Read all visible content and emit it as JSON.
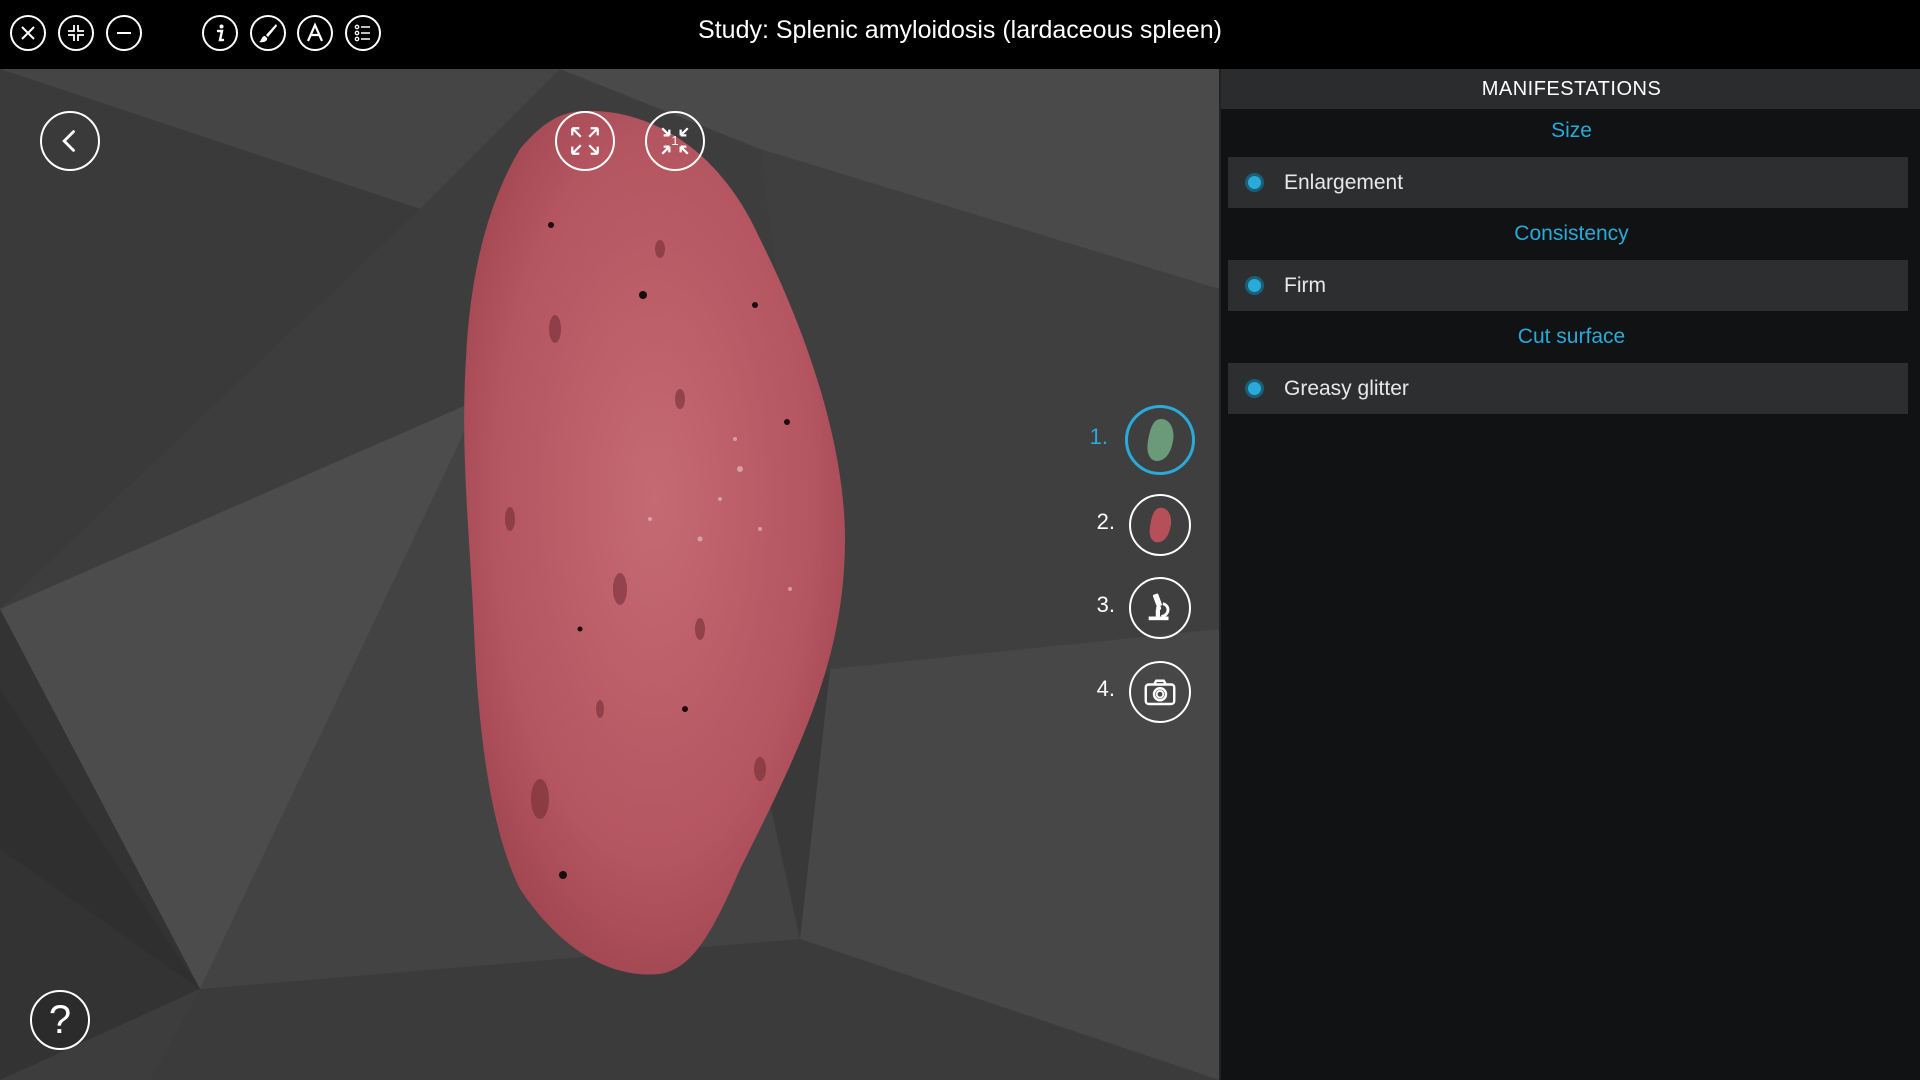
{
  "window": {
    "title": "Study: Splenic amyloidosis (lardaceous spleen)"
  },
  "toolbar": {
    "buttons": [
      {
        "name": "close",
        "icon": "close-icon"
      },
      {
        "name": "compress",
        "icon": "compress-icon"
      },
      {
        "name": "minimize",
        "icon": "minus-icon"
      },
      {
        "name": "info",
        "icon": "info-icon"
      },
      {
        "name": "brush",
        "icon": "brush-icon"
      },
      {
        "name": "labels",
        "icon": "letter-a-icon"
      },
      {
        "name": "list",
        "icon": "list-icon"
      }
    ]
  },
  "viewer": {
    "fit_badge": "1",
    "steps": [
      {
        "label": "1.",
        "icon": "spleen-green-icon",
        "active": true
      },
      {
        "label": "2.",
        "icon": "spleen-red-icon",
        "active": false
      },
      {
        "label": "3.",
        "icon": "microscope-icon",
        "active": false
      },
      {
        "label": "4.",
        "icon": "camera-icon",
        "active": false
      }
    ],
    "help_label": "?"
  },
  "panel": {
    "header": "MANIFESTATIONS",
    "sections": [
      {
        "title": "Size",
        "items": [
          "Enlargement"
        ]
      },
      {
        "title": "Consistency",
        "items": [
          "Firm"
        ]
      },
      {
        "title": "Cut surface",
        "items": [
          "Greasy glitter"
        ]
      }
    ]
  },
  "colors": {
    "accent": "#2aaad8",
    "specimen": "#b85a63",
    "panel_bg": "#111213",
    "item_bg": "#2d2e30"
  }
}
